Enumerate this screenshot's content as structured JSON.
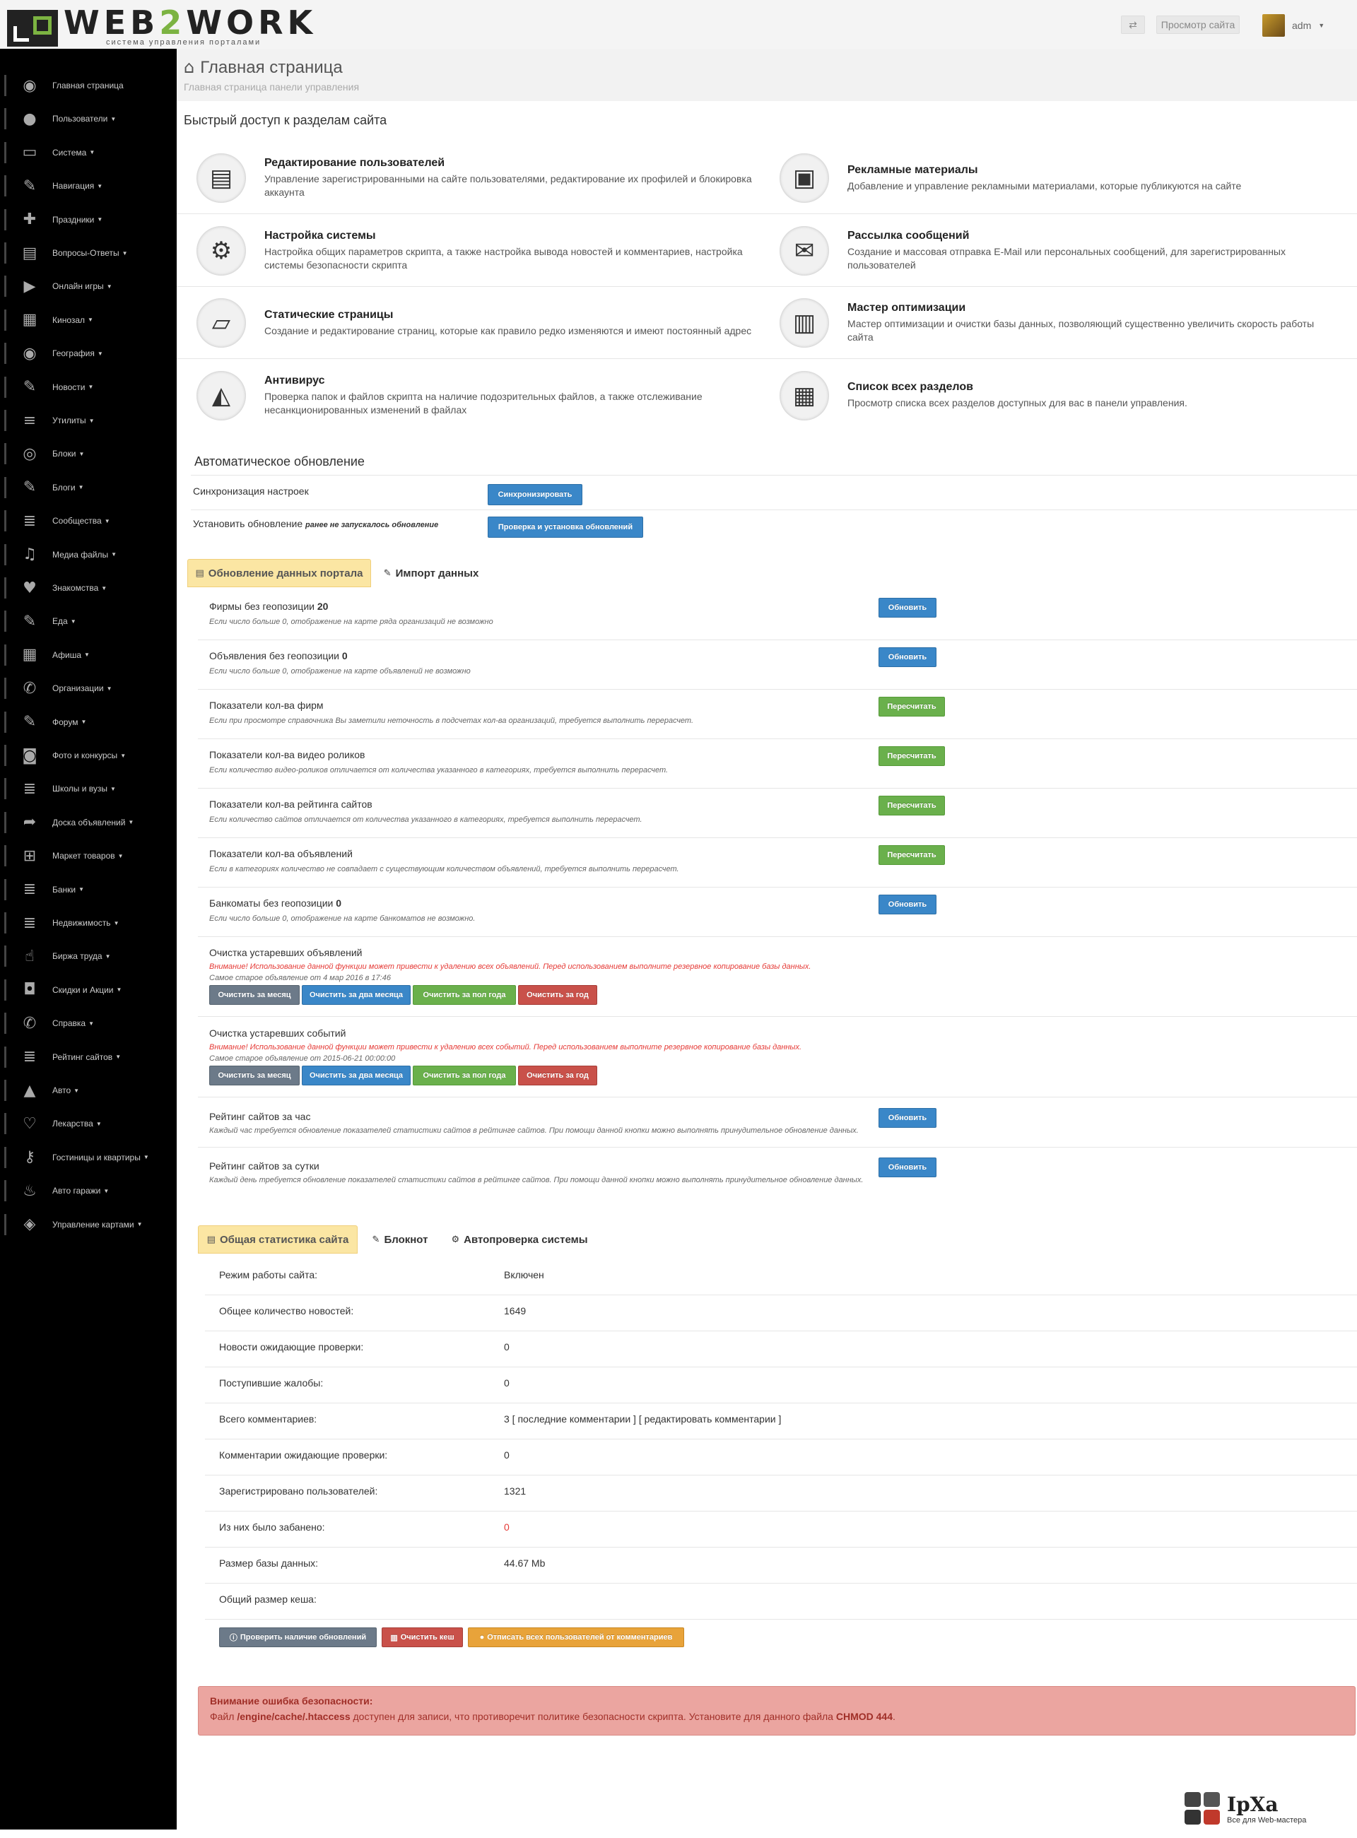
{
  "header": {
    "logo_text_a": "WEB",
    "logo_text_b": "2",
    "logo_text_c": "WORK",
    "logo_subtitle": "система управления порталами",
    "switch_icon": "⇄",
    "view_site": "Просмотр сайта",
    "user": "adm"
  },
  "sidebar": {
    "items": [
      {
        "label": "Главная страница",
        "icon": "globe-icon",
        "glyph": "◉",
        "caret": false
      },
      {
        "label": "Пользователи",
        "icon": "user-icon",
        "glyph": "●",
        "caret": true
      },
      {
        "label": "Система",
        "icon": "monitor-icon",
        "glyph": "▭",
        "caret": true
      },
      {
        "label": "Навигация",
        "icon": "wrench-icon",
        "glyph": "✎",
        "caret": true
      },
      {
        "label": "Праздники",
        "icon": "gift-icon",
        "glyph": "✚",
        "caret": true
      },
      {
        "label": "Вопросы-Ответы",
        "icon": "book-icon",
        "glyph": "▤",
        "caret": true
      },
      {
        "label": "Онлайн игры",
        "icon": "play-icon",
        "glyph": "▶",
        "caret": true
      },
      {
        "label": "Кинозал",
        "icon": "film-icon",
        "glyph": "▦",
        "caret": true
      },
      {
        "label": "География",
        "icon": "globe-icon",
        "glyph": "◉",
        "caret": true
      },
      {
        "label": "Новости",
        "icon": "pencil-icon",
        "glyph": "✎",
        "caret": true
      },
      {
        "label": "Утилиты",
        "icon": "list-icon",
        "glyph": "≡",
        "caret": true
      },
      {
        "label": "Блоки",
        "icon": "eye-icon",
        "glyph": "◎",
        "caret": true
      },
      {
        "label": "Блоги",
        "icon": "wrench-icon",
        "glyph": "✎",
        "caret": true
      },
      {
        "label": "Сообщества",
        "icon": "list-icon",
        "glyph": "≣",
        "caret": true
      },
      {
        "label": "Медиа файлы",
        "icon": "music-icon",
        "glyph": "♫",
        "caret": true
      },
      {
        "label": "Знакомства",
        "icon": "heart-icon",
        "glyph": "♥",
        "caret": true
      },
      {
        "label": "Еда",
        "icon": "pencil-icon",
        "glyph": "✎",
        "caret": true
      },
      {
        "label": "Афиша",
        "icon": "calendar-icon",
        "glyph": "▦",
        "caret": true
      },
      {
        "label": "Организации",
        "icon": "phone-icon",
        "glyph": "✆",
        "caret": true
      },
      {
        "label": "Форум",
        "icon": "wrench-icon",
        "glyph": "✎",
        "caret": true
      },
      {
        "label": "Фото и конкурсы",
        "icon": "camera-icon",
        "glyph": "◙",
        "caret": true
      },
      {
        "label": "Школы и вузы",
        "icon": "list-icon",
        "glyph": "≣",
        "caret": true
      },
      {
        "label": "Доска объявлений",
        "icon": "share-icon",
        "glyph": "➦",
        "caret": true
      },
      {
        "label": "Маркет товаров",
        "icon": "cart-icon",
        "glyph": "⊞",
        "caret": true
      },
      {
        "label": "Банки",
        "icon": "list-icon",
        "glyph": "≣",
        "caret": true
      },
      {
        "label": "Недвижимость",
        "icon": "list-icon",
        "glyph": "≣",
        "caret": true
      },
      {
        "label": "Биржа труда",
        "icon": "hand-icon",
        "glyph": "☝",
        "caret": true
      },
      {
        "label": "Скидки и Акции",
        "icon": "lock-icon",
        "glyph": "◘",
        "caret": true
      },
      {
        "label": "Справка",
        "icon": "phone-icon",
        "glyph": "✆",
        "caret": true
      },
      {
        "label": "Рейтинг сайтов",
        "icon": "ordered-list-icon",
        "glyph": "≣",
        "caret": true
      },
      {
        "label": "Авто",
        "icon": "road-icon",
        "glyph": "▲",
        "caret": true
      },
      {
        "label": "Лекарства",
        "icon": "heart-icon",
        "glyph": "♡",
        "caret": true
      },
      {
        "label": "Гостиницы и квартиры",
        "icon": "key-icon",
        "glyph": "⚷",
        "caret": true
      },
      {
        "label": "Авто гаражи",
        "icon": "fire-icon",
        "glyph": "♨",
        "caret": true
      },
      {
        "label": "Управление картами",
        "icon": "map-marker-icon",
        "glyph": "◈",
        "caret": true
      }
    ]
  },
  "page": {
    "title": "Главная страница",
    "subtitle": "Главная страница панели управления",
    "home_glyph": "⌂"
  },
  "quick_access": {
    "heading": "Быстрый доступ к разделам сайта",
    "items": [
      {
        "title": "Редактирование пользователей",
        "desc": "Управление зарегистрированными на сайте пользователями, редактирование их профилей и блокировка аккаунта",
        "glyph": "▤",
        "icon": "users-doc-icon"
      },
      {
        "title": "Рекламные материалы",
        "desc": "Добавление и управление рекламными материалами, которые публикуются на сайте",
        "glyph": "▣",
        "icon": "billboard-icon"
      },
      {
        "title": "Настройка системы",
        "desc": "Настройка общих параметров скрипта, а также настройка вывода новостей и комментариев, настройка системы безопасности скрипта",
        "glyph": "⚙",
        "icon": "toolbox-icon"
      },
      {
        "title": "Рассылка сообщений",
        "desc": "Создание и массовая отправка E-Mail или персональных сообщений, для зарегистрированных пользователей",
        "glyph": "✉",
        "icon": "mailbox-icon"
      },
      {
        "title": "Статические страницы",
        "desc": "Создание и редактирование страниц, которые как правило редко изменяются и имеют постоянный адрес",
        "glyph": "▱",
        "icon": "book-icon"
      },
      {
        "title": "Мастер оптимизации",
        "desc": "Мастер оптимизации и очистки базы данных, позволяющий существенно увеличить скорость работы сайта",
        "glyph": "▥",
        "icon": "chart-icon"
      },
      {
        "title": "Антивирус",
        "desc": "Проверка папок и файлов скрипта на наличие подозрительных файлов, а также отслеживание несанкционированных изменений в файлах",
        "glyph": "◭",
        "icon": "shield-icon"
      },
      {
        "title": "Список всех разделов",
        "desc": "Просмотр списка всех разделов доступных для вас в панели управления.",
        "glyph": "▦",
        "icon": "clipboard-icon"
      }
    ]
  },
  "auto_update": {
    "heading": "Автоматическое обновление",
    "sync_label": "Синхронизация настроек",
    "sync_button": "Синхронизировать",
    "install_label": "Установить обновление",
    "install_note": "ранее не запускалось обновление",
    "install_button": "Проверка и установка обновлений"
  },
  "tabs1": {
    "active": "Обновление данных портала",
    "other": "Импорт данных",
    "active_glyph": "▤",
    "other_glyph": "✎"
  },
  "portal_rows": [
    {
      "title": "Фирмы без геопозиции",
      "count": "20",
      "note": "Если число больше 0, отображение на карте ряда организаций не возможно",
      "button": "Обновить",
      "kind": "blue"
    },
    {
      "title": "Объявления без геопозиции",
      "count": "0",
      "note": "Если число больше 0, отображение на карте объявлений не возможно",
      "button": "Обновить",
      "kind": "blue"
    },
    {
      "title": "Показатели кол-ва фирм",
      "count": "",
      "note": "Если при просмотре справочника Вы заметили неточность в подсчетах кол-ва организаций, требуется выполнить перерасчет.",
      "button": "Пересчитать",
      "kind": "green"
    },
    {
      "title": "Показатели кол-ва видео роликов",
      "count": "",
      "note": "Если количество видео-роликов отличается от количества указанного в категориях, требуется выполнить перерасчет.",
      "button": "Пересчитать",
      "kind": "green"
    },
    {
      "title": "Показатели кол-ва рейтинга сайтов",
      "count": "",
      "note": "Если количество сайтов отличается от количества указанного в категориях, требуется выполнить перерасчет.",
      "button": "Пересчитать",
      "kind": "green"
    },
    {
      "title": "Показатели кол-ва объявлений",
      "count": "",
      "note": "Если в категориях количество не совпадает с существующим количеством объявлений, требуется выполнить перерасчет.",
      "button": "Пересчитать",
      "kind": "green"
    },
    {
      "title": "Банкоматы без геопозиции",
      "count": "0",
      "note": "Если число больше 0, отображение на карте банкоматов не возможно.",
      "button": "Обновить",
      "kind": "blue"
    }
  ],
  "cleanup": [
    {
      "title": "Очистка устаревших объявлений",
      "warn": "Внимание! Использование данной функции может привести к удалению всех объявлений. Перед использованием выполните резервное копирование базы данных.",
      "oldest": "Самое старое объявление от 4 мар 2016 в 17:46"
    },
    {
      "title": "Очистка устаревших событий",
      "warn": "Внимание! Использование данной функции может привести к удалению всех событий. Перед использованием выполните резервное копирование базы данных.",
      "oldest": "Самое старое объявление от 2015-06-21 00:00:00"
    }
  ],
  "cleanup_buttons": [
    "Очистить за месяц",
    "Очистить за два месяца",
    "Очистить за пол года",
    "Очистить за год"
  ],
  "rating_rows": [
    {
      "title": "Рейтинг сайтов за час",
      "note": "Каждый час требуется обновление показателей статистики сайтов в рейтинге сайтов. При помощи данной кнопки можно выполнять принудительное обновление данных.",
      "button": "Обновить"
    },
    {
      "title": "Рейтинг сайтов за сутки",
      "note": "Каждый день требуется обновление показателей статистики сайтов в рейтинге сайтов. При помощи данной кнопки можно выполнять принудительное обновление данных.",
      "button": "Обновить"
    }
  ],
  "tabs2": {
    "active": "Общая статистика сайта",
    "notepad": "Блокнот",
    "autocheck": "Автопроверка системы",
    "active_glyph": "▤",
    "notepad_glyph": "✎",
    "autocheck_glyph": "⚙"
  },
  "stats": [
    {
      "label": "Режим работы сайта:",
      "value": "Включен",
      "red": false
    },
    {
      "label": "Общее количество новостей:",
      "value": "1649",
      "red": false
    },
    {
      "label": "Новости ожидающие проверки:",
      "value": "0",
      "red": false
    },
    {
      "label": "Поступившие жалобы:",
      "value": "0",
      "red": false
    },
    {
      "label": "Всего комментариев:",
      "value": "3 [ последние комментарии ] [ редактировать комментарии ]",
      "red": false
    },
    {
      "label": "Комментарии ожидающие проверки:",
      "value": "0",
      "red": false
    },
    {
      "label": "Зарегистрировано пользователей:",
      "value": "1321",
      "red": false
    },
    {
      "label": "Из них было забанено:",
      "value": "0",
      "red": true
    },
    {
      "label": "Размер базы данных:",
      "value": "44.67 Mb",
      "red": false
    },
    {
      "label": "Общий размер кеша:",
      "value": "",
      "red": false
    }
  ],
  "bottom_buttons": {
    "check": "Проверить наличие обновлений",
    "clear_cache": "Очистить кеш",
    "unsubscribe": "Отписать всех пользователей от комментариев"
  },
  "alert": {
    "title": "Внимание ошибка безопасности:",
    "text_pre": "Файл ",
    "file": "/engine/cache/.htaccess",
    "text_mid": " доступен для записи, что противоречит политике безопасности скрипта. Установите для данного файла ",
    "chmod": "CHMOD 444",
    "text_post": "."
  },
  "watermark": {
    "logo": "IpXa",
    "sub": "Все для Web-мастера"
  },
  "colors": {
    "accent_green": "#7cb342",
    "btn_blue": "#3a87c8",
    "btn_green": "#6ab04c",
    "btn_gray": "#6c7a89",
    "btn_red": "#c9514a",
    "btn_orange": "#e8a33a",
    "tab_active": "#fbe6a3",
    "alert_bg": "#eba5a0"
  }
}
